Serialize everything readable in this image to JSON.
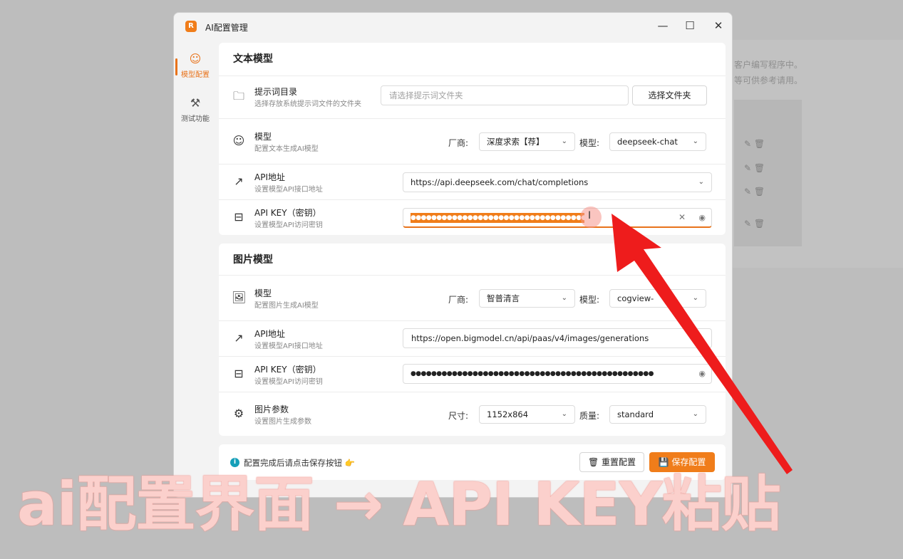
{
  "background": {
    "line1": "客户编写程序中。",
    "line2": "等可供参考请用。"
  },
  "window": {
    "app_logo": "R",
    "title": "AI配置管理",
    "controls": {
      "minimize": "—",
      "maximize": "☐",
      "close": "✕"
    }
  },
  "nav": [
    {
      "label": "模型配置",
      "icon": "robot-icon",
      "active": true
    },
    {
      "label": "测试功能",
      "icon": "tools-icon",
      "active": false
    }
  ],
  "text_model": {
    "section_title": "文本模型",
    "prompt_dir": {
      "title": "提示词目录",
      "subtitle": "选择存放系统提示词文件的文件夹",
      "placeholder": "请选择提示词文件夹",
      "button": "选择文件夹"
    },
    "model": {
      "title": "模型",
      "subtitle": "配置文本生成AI模型",
      "vendor_label": "厂商:",
      "vendor_value": "深度求索【荐】",
      "model_label": "模型:",
      "model_value": "deepseek-chat"
    },
    "api_url": {
      "title": "API地址",
      "subtitle": "设置模型API接口地址",
      "value": "https://api.deepseek.com/chat/completions"
    },
    "api_key": {
      "title": "API KEY（密钥）",
      "subtitle": "设置模型API访问密钥",
      "masked": "●●●●●●●●●●●●●●●●●●●●●●●●●●●●●●●●●●●",
      "clear_icon": "✕",
      "eye_icon": "◉"
    }
  },
  "image_model": {
    "section_title": "图片模型",
    "model": {
      "title": "模型",
      "subtitle": "配置图片生成AI模型",
      "vendor_label": "厂商:",
      "vendor_value": "智普清言",
      "model_label": "模型:",
      "model_value": "cogview-"
    },
    "api_url": {
      "title": "API地址",
      "subtitle": "设置模型API接口地址",
      "value": "https://open.bigmodel.cn/api/paas/v4/images/generations"
    },
    "api_key": {
      "title": "API KEY（密钥）",
      "subtitle": "设置模型API访问密钥",
      "masked": "●●●●●●●●●●●●●●●●●●●●●●●●●●●●●●●●●●●●●●●●●●●●●●●",
      "eye_icon": "◉"
    },
    "params": {
      "title": "图片参数",
      "subtitle": "设置图片生成参数",
      "size_label": "尺寸:",
      "size_value": "1152x864",
      "quality_label": "质量:",
      "quality_value": "standard"
    }
  },
  "footer": {
    "info_icon": "i",
    "hint": "配置完成后请点击保存按钮 👉",
    "reset_button": "重置配置",
    "save_button": "保存配置"
  },
  "overlay": {
    "caption": "ai配置界面 → API KEY粘贴",
    "arrow_color": "#ee1c1c"
  },
  "colors": {
    "accent": "#f07d1a",
    "info": "#159fb8"
  }
}
